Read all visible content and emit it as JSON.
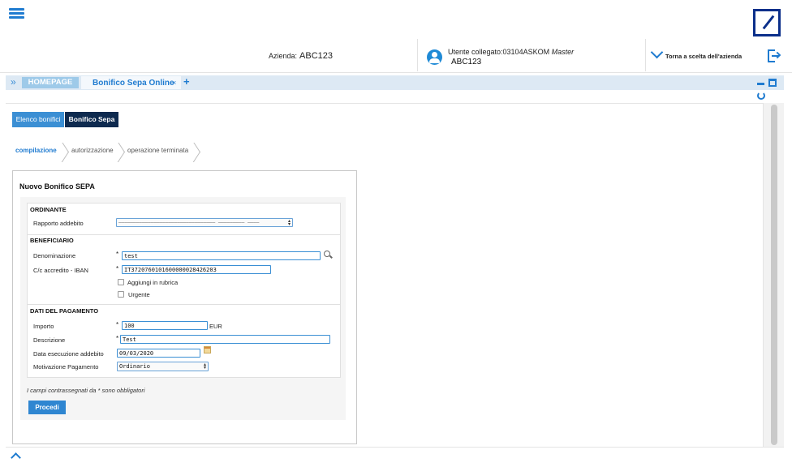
{
  "header": {
    "azienda_label": "Azienda:",
    "azienda_value": "ABC123",
    "utente_label": "Utente collegato:03104ASKOM",
    "utente_role": "Master",
    "utente_azienda": "ABC123",
    "torna_label": "Torna a scelta dell'azienda"
  },
  "icons": {
    "menu": "hamburger-menu-icon",
    "logo": "brand-logo",
    "user": "user-icon",
    "back": "chevron-down-icon",
    "logout": "logout-icon",
    "search": "search-icon",
    "calendar": "calendar-icon",
    "refresh": "refresh-icon"
  },
  "colors": {
    "accent": "#1f7bd0",
    "brand_dark": "#0e2a4f",
    "tab_home": "#9ecae9",
    "tabbar": "#dde9f4"
  },
  "tabs": {
    "expand": "»",
    "home": "HOMEPAGE",
    "active": "Bonifico Sepa Online",
    "close": "×",
    "add": "+"
  },
  "subtabs": {
    "elenco": "Elenco bonifici",
    "sepa": "Bonifico Sepa"
  },
  "steps": [
    "compilazione",
    "autorizzazione",
    "operazione terminata"
  ],
  "form": {
    "title": "Nuovo Bonifico SEPA",
    "ordinante": {
      "title": "ORDINANTE",
      "rapporto_label": "Rapporto addebito",
      "rapporto_value": "––––––––––––––––––––––––––––––––– ––––––––– ––––"
    },
    "beneficiario": {
      "title": "BENEFICIARIO",
      "denominazione_label": "Denominazione",
      "denominazione_value": "test",
      "iban_label": "C/c accredito - IBAN",
      "iban_value": "IT3720760101600000028426203",
      "rubrica_label": "Aggiungi in rubrica",
      "urgente_label": "Urgente"
    },
    "pagamento": {
      "title": "DATI DEL PAGAMENTO",
      "importo_label": "Importo",
      "importo_value": "100",
      "currency": "EUR",
      "descrizione_label": "Descrizione",
      "descrizione_value": "Test",
      "data_label": "Data esecuzione addebito",
      "data_value": "09/03/2020",
      "motivazione_label": "Motivazione Pagamento",
      "motivazione_value": "Ordinario"
    },
    "required_star": "*",
    "note": "I campi contrassegnati da * sono obbligatori",
    "submit": "Procedi"
  }
}
